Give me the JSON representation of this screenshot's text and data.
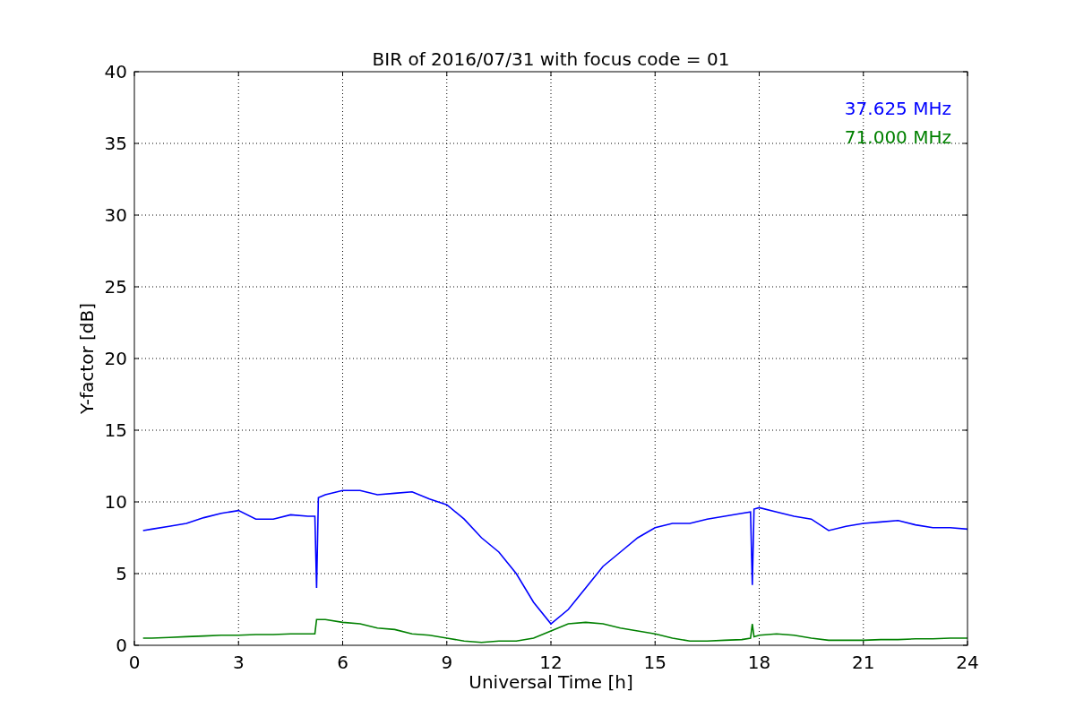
{
  "figure": {
    "chart_data": {
      "type": "line",
      "title": "BIR of 2016/07/31 with focus code = 01",
      "xlabel": "Universal Time [h]",
      "ylabel": "Y-factor [dB]",
      "x": [
        0.25,
        0.5,
        1,
        1.5,
        2,
        2.5,
        3,
        3.5,
        4,
        4.5,
        5,
        5.2,
        5.25,
        5.3,
        5.5,
        6,
        6.5,
        7,
        7.5,
        8,
        8.5,
        9,
        9.5,
        10,
        10.5,
        11,
        11.5,
        12,
        12.5,
        13,
        13.5,
        14,
        14.5,
        15,
        15.5,
        16,
        16.5,
        17,
        17.5,
        17.75,
        17.8,
        17.85,
        18,
        18.5,
        19,
        19.5,
        20,
        20.5,
        21,
        21.5,
        22,
        22.5,
        23,
        23.5,
        24
      ],
      "series": [
        {
          "name": "37.625 MHz",
          "color": "#0000ff",
          "values": [
            8.0,
            8.1,
            8.3,
            8.5,
            8.9,
            9.2,
            9.4,
            8.8,
            8.8,
            9.1,
            9.0,
            9.0,
            4.0,
            10.3,
            10.5,
            10.8,
            10.8,
            10.5,
            10.6,
            10.7,
            10.2,
            9.8,
            8.8,
            7.5,
            6.5,
            5.0,
            3.0,
            1.5,
            2.5,
            4.0,
            5.5,
            6.5,
            7.5,
            8.2,
            8.5,
            8.5,
            8.8,
            9.0,
            9.2,
            9.3,
            4.2,
            9.5,
            9.6,
            9.3,
            9.0,
            8.8,
            8.0,
            8.3,
            8.5,
            8.6,
            8.7,
            8.4,
            8.2,
            8.2,
            8.1
          ]
        },
        {
          "name": "71.000 MHz",
          "color": "#008000",
          "values": [
            0.5,
            0.5,
            0.55,
            0.6,
            0.65,
            0.7,
            0.7,
            0.75,
            0.75,
            0.8,
            0.8,
            0.8,
            1.8,
            1.8,
            1.8,
            1.6,
            1.5,
            1.2,
            1.1,
            0.8,
            0.7,
            0.5,
            0.3,
            0.2,
            0.3,
            0.3,
            0.5,
            1.0,
            1.5,
            1.6,
            1.5,
            1.2,
            1.0,
            0.8,
            0.5,
            0.3,
            0.3,
            0.35,
            0.4,
            0.5,
            1.5,
            0.6,
            0.7,
            0.8,
            0.7,
            0.5,
            0.35,
            0.35,
            0.35,
            0.4,
            0.4,
            0.45,
            0.45,
            0.5,
            0.5
          ]
        }
      ],
      "xlim": [
        0,
        24
      ],
      "ylim": [
        0,
        40
      ],
      "xticks": [
        0,
        3,
        6,
        9,
        12,
        15,
        18,
        21,
        24
      ],
      "yticks": [
        0,
        5,
        10,
        15,
        20,
        25,
        30,
        35,
        40
      ],
      "grid": true
    }
  }
}
